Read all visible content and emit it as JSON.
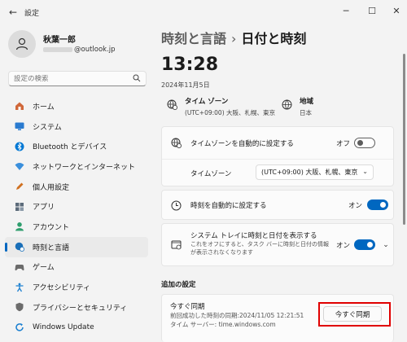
{
  "titlebar": {
    "back": "←",
    "title": "設定",
    "minimize": "─",
    "maximize": "☐",
    "close": "✕"
  },
  "profile": {
    "name": "秋葉一郎",
    "email_suffix": "@outlook.jp"
  },
  "search": {
    "placeholder": "設定の検索"
  },
  "nav": [
    {
      "label": "ホーム",
      "icon": "home-icon",
      "color": "#d0683a"
    },
    {
      "label": "システム",
      "icon": "monitor-icon",
      "color": "#2a7bd0"
    },
    {
      "label": "Bluetooth とデバイス",
      "icon": "bluetooth-icon",
      "color": "#0078d4"
    },
    {
      "label": "ネットワークとインターネット",
      "icon": "wifi-icon",
      "color": "#3a8fdc"
    },
    {
      "label": "個人用設定",
      "icon": "pen-icon",
      "color": "#d07020"
    },
    {
      "label": "アプリ",
      "icon": "apps-icon",
      "color": "#5c6b7a"
    },
    {
      "label": "アカウント",
      "icon": "account-icon",
      "color": "#2f9e6e"
    },
    {
      "label": "時刻と言語",
      "icon": "globe-clock-icon",
      "color": "#1a6fb8",
      "selected": true
    },
    {
      "label": "ゲーム",
      "icon": "gamepad-icon",
      "color": "#6b6b6b"
    },
    {
      "label": "アクセシビリティ",
      "icon": "accessibility-icon",
      "color": "#1a7fd0"
    },
    {
      "label": "プライバシーとセキュリティ",
      "icon": "shield-icon",
      "color": "#6b6b6b"
    },
    {
      "label": "Windows Update",
      "icon": "update-icon",
      "color": "#1a7fd0"
    }
  ],
  "breadcrumb": {
    "parent": "時刻と言語",
    "separator": "›",
    "current": "日付と時刻"
  },
  "clock": {
    "time": "13:28",
    "date": "2024年11月5日"
  },
  "timezone_info": {
    "title": "タイム ゾーン",
    "value": "(UTC+09:00) 大阪、札幌、東京"
  },
  "region_info": {
    "title": "地域",
    "value": "日本"
  },
  "auto_timezone": {
    "label": "タイムゾーンを自動的に設定する",
    "state_text": "オフ",
    "state": false,
    "sub_label": "タイムゾーン",
    "selected_timezone": "(UTC+09:00) 大阪、札幌、東京"
  },
  "auto_time": {
    "label": "時刻を自動的に設定する",
    "state_text": "オン",
    "state": true
  },
  "tray_clock": {
    "label": "システム トレイに時刻と日付を表示する",
    "description": "これをオフにすると、タスク バーに時刻と日付の情報が表示されなくなります",
    "state_text": "オン",
    "state": true
  },
  "additional": {
    "section_title": "追加の設定",
    "sync_title": "今すぐ同期",
    "last_sync": "前回成功した時刻の同期:2024/11/05 12:21:51",
    "time_server": "タイム サーバー: time.windows.com",
    "sync_button": "今すぐ同期"
  },
  "colors": {
    "accent": "#0067c0",
    "highlight": "#e00000"
  }
}
